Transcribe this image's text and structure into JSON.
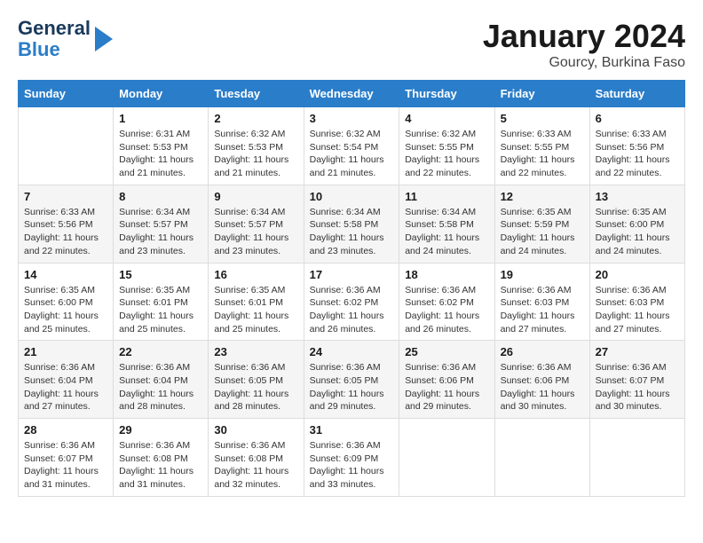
{
  "header": {
    "logo_line1": "General",
    "logo_line2": "Blue",
    "month": "January 2024",
    "location": "Gourcy, Burkina Faso"
  },
  "weekdays": [
    "Sunday",
    "Monday",
    "Tuesday",
    "Wednesday",
    "Thursday",
    "Friday",
    "Saturday"
  ],
  "weeks": [
    [
      {
        "day": "",
        "info": ""
      },
      {
        "day": "1",
        "info": "Sunrise: 6:31 AM\nSunset: 5:53 PM\nDaylight: 11 hours\nand 21 minutes."
      },
      {
        "day": "2",
        "info": "Sunrise: 6:32 AM\nSunset: 5:53 PM\nDaylight: 11 hours\nand 21 minutes."
      },
      {
        "day": "3",
        "info": "Sunrise: 6:32 AM\nSunset: 5:54 PM\nDaylight: 11 hours\nand 21 minutes."
      },
      {
        "day": "4",
        "info": "Sunrise: 6:32 AM\nSunset: 5:55 PM\nDaylight: 11 hours\nand 22 minutes."
      },
      {
        "day": "5",
        "info": "Sunrise: 6:33 AM\nSunset: 5:55 PM\nDaylight: 11 hours\nand 22 minutes."
      },
      {
        "day": "6",
        "info": "Sunrise: 6:33 AM\nSunset: 5:56 PM\nDaylight: 11 hours\nand 22 minutes."
      }
    ],
    [
      {
        "day": "7",
        "info": "Sunrise: 6:33 AM\nSunset: 5:56 PM\nDaylight: 11 hours\nand 22 minutes."
      },
      {
        "day": "8",
        "info": "Sunrise: 6:34 AM\nSunset: 5:57 PM\nDaylight: 11 hours\nand 23 minutes."
      },
      {
        "day": "9",
        "info": "Sunrise: 6:34 AM\nSunset: 5:57 PM\nDaylight: 11 hours\nand 23 minutes."
      },
      {
        "day": "10",
        "info": "Sunrise: 6:34 AM\nSunset: 5:58 PM\nDaylight: 11 hours\nand 23 minutes."
      },
      {
        "day": "11",
        "info": "Sunrise: 6:34 AM\nSunset: 5:58 PM\nDaylight: 11 hours\nand 24 minutes."
      },
      {
        "day": "12",
        "info": "Sunrise: 6:35 AM\nSunset: 5:59 PM\nDaylight: 11 hours\nand 24 minutes."
      },
      {
        "day": "13",
        "info": "Sunrise: 6:35 AM\nSunset: 6:00 PM\nDaylight: 11 hours\nand 24 minutes."
      }
    ],
    [
      {
        "day": "14",
        "info": "Sunrise: 6:35 AM\nSunset: 6:00 PM\nDaylight: 11 hours\nand 25 minutes."
      },
      {
        "day": "15",
        "info": "Sunrise: 6:35 AM\nSunset: 6:01 PM\nDaylight: 11 hours\nand 25 minutes."
      },
      {
        "day": "16",
        "info": "Sunrise: 6:35 AM\nSunset: 6:01 PM\nDaylight: 11 hours\nand 25 minutes."
      },
      {
        "day": "17",
        "info": "Sunrise: 6:36 AM\nSunset: 6:02 PM\nDaylight: 11 hours\nand 26 minutes."
      },
      {
        "day": "18",
        "info": "Sunrise: 6:36 AM\nSunset: 6:02 PM\nDaylight: 11 hours\nand 26 minutes."
      },
      {
        "day": "19",
        "info": "Sunrise: 6:36 AM\nSunset: 6:03 PM\nDaylight: 11 hours\nand 27 minutes."
      },
      {
        "day": "20",
        "info": "Sunrise: 6:36 AM\nSunset: 6:03 PM\nDaylight: 11 hours\nand 27 minutes."
      }
    ],
    [
      {
        "day": "21",
        "info": "Sunrise: 6:36 AM\nSunset: 6:04 PM\nDaylight: 11 hours\nand 27 minutes."
      },
      {
        "day": "22",
        "info": "Sunrise: 6:36 AM\nSunset: 6:04 PM\nDaylight: 11 hours\nand 28 minutes."
      },
      {
        "day": "23",
        "info": "Sunrise: 6:36 AM\nSunset: 6:05 PM\nDaylight: 11 hours\nand 28 minutes."
      },
      {
        "day": "24",
        "info": "Sunrise: 6:36 AM\nSunset: 6:05 PM\nDaylight: 11 hours\nand 29 minutes."
      },
      {
        "day": "25",
        "info": "Sunrise: 6:36 AM\nSunset: 6:06 PM\nDaylight: 11 hours\nand 29 minutes."
      },
      {
        "day": "26",
        "info": "Sunrise: 6:36 AM\nSunset: 6:06 PM\nDaylight: 11 hours\nand 30 minutes."
      },
      {
        "day": "27",
        "info": "Sunrise: 6:36 AM\nSunset: 6:07 PM\nDaylight: 11 hours\nand 30 minutes."
      }
    ],
    [
      {
        "day": "28",
        "info": "Sunrise: 6:36 AM\nSunset: 6:07 PM\nDaylight: 11 hours\nand 31 minutes."
      },
      {
        "day": "29",
        "info": "Sunrise: 6:36 AM\nSunset: 6:08 PM\nDaylight: 11 hours\nand 31 minutes."
      },
      {
        "day": "30",
        "info": "Sunrise: 6:36 AM\nSunset: 6:08 PM\nDaylight: 11 hours\nand 32 minutes."
      },
      {
        "day": "31",
        "info": "Sunrise: 6:36 AM\nSunset: 6:09 PM\nDaylight: 11 hours\nand 33 minutes."
      },
      {
        "day": "",
        "info": ""
      },
      {
        "day": "",
        "info": ""
      },
      {
        "day": "",
        "info": ""
      }
    ]
  ]
}
